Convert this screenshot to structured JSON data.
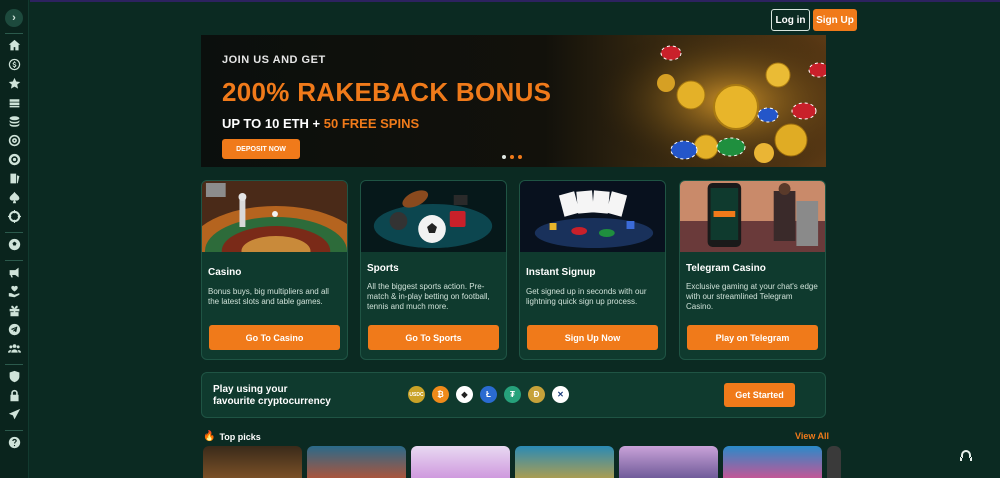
{
  "sidebar": {
    "icons": [
      "home-icon",
      "dollar-icon",
      "star-icon",
      "money-stack-icon",
      "coin-stack-icon",
      "target-icon",
      "chip-icon",
      "cards-icon",
      "spade-icon",
      "roulette-icon",
      "soccer-icon",
      "megaphone-icon",
      "heart-hand-icon",
      "gift-icon",
      "telegram-icon",
      "people-icon",
      "shield-icon",
      "lock-icon",
      "plane-icon",
      "help-icon"
    ]
  },
  "header": {
    "login_label": "Log in",
    "signup_label": "Sign Up"
  },
  "banner": {
    "kicker": "JOIN US AND GET",
    "title": "200% RAKEBACK BONUS",
    "sub_prefix": "UP TO 10 ETH + ",
    "sub_highlight": "50 FREE SPINS",
    "cta": "DEPOSIT NOW"
  },
  "cards": [
    {
      "title": "Casino",
      "desc": "Bonus buys, big multipliers and all the latest slots and table games.",
      "button": "Go To Casino"
    },
    {
      "title": "Sports",
      "desc": "All the biggest sports action. Pre-match & in-play betting on football, tennis and much more.",
      "button": "Go To Sports"
    },
    {
      "title": "Instant Signup",
      "desc": "Get signed up in seconds with our lightning quick sign up process.",
      "button": "Sign Up Now"
    },
    {
      "title": "Telegram Casino",
      "desc": "Exclusive gaming at your chat's edge with our streamlined Telegram Casino.",
      "button": "Play on Telegram"
    }
  ],
  "crypto": {
    "text_line1": "Play using your",
    "text_line2": "favourite cryptocurrency",
    "coins": [
      "USDC",
      "BTC",
      "ETH",
      "LTC",
      "USDT",
      "DOGE",
      "XRP"
    ],
    "coin_colors": [
      "#c9a227",
      "#f08a1a",
      "#ffffff",
      "#2a6bd1",
      "#26a17b",
      "#c7a23a",
      "#ffffff"
    ],
    "button": "Get Started"
  },
  "top_picks": {
    "title": "Top picks",
    "view_all": "View All"
  },
  "colors": {
    "accent": "#f07a1a",
    "background": "#0b2a22",
    "card": "#0f3a2e"
  }
}
